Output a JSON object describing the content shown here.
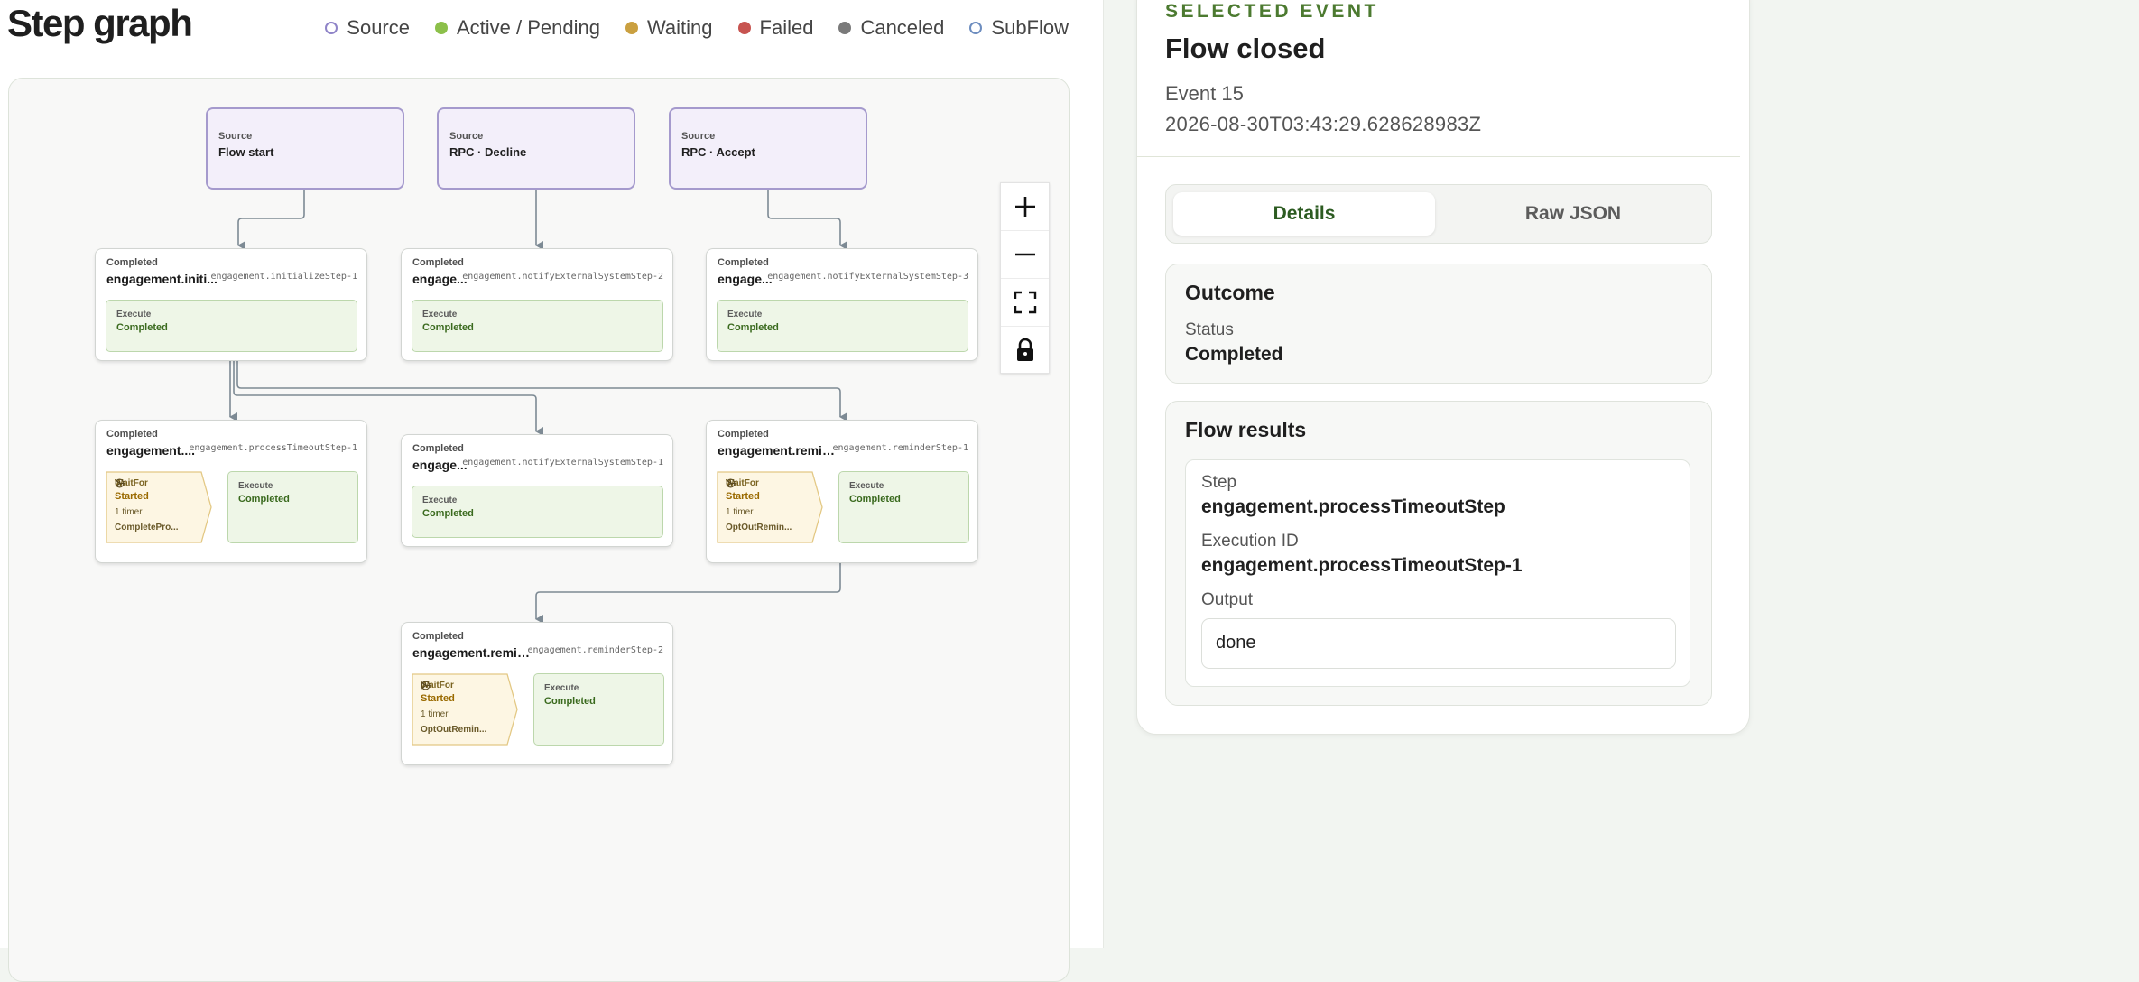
{
  "graph": {
    "title": "Step graph",
    "legend": [
      {
        "label": "Source",
        "color": "#8f84c8",
        "style": "ring"
      },
      {
        "label": "Active / Pending",
        "color": "#8cc04a",
        "style": "fill"
      },
      {
        "label": "Waiting",
        "color": "#caa040",
        "style": "fill"
      },
      {
        "label": "Failed",
        "color": "#c75450",
        "style": "fill"
      },
      {
        "label": "Canceled",
        "color": "#7a7a7a",
        "style": "fill"
      },
      {
        "label": "SubFlow",
        "color": "#6d8dbf",
        "style": "ring"
      }
    ],
    "sources": [
      {
        "kind": "Source",
        "name": "Flow start"
      },
      {
        "kind": "Source",
        "name": "RPC · Decline"
      },
      {
        "kind": "Source",
        "name": "RPC · Accept"
      }
    ],
    "steps": [
      {
        "status": "Completed",
        "name": "engagement.initi...",
        "exec_id": "engagement.initializeStep-1",
        "execute": {
          "kind": "Execute",
          "status": "Completed"
        }
      },
      {
        "status": "Completed",
        "name": "engage...",
        "exec_id": "engagement.notifyExternalSystemStep-2",
        "execute": {
          "kind": "Execute",
          "status": "Completed"
        }
      },
      {
        "status": "Completed",
        "name": "engage...",
        "exec_id": "engagement.notifyExternalSystemStep-3",
        "execute": {
          "kind": "Execute",
          "status": "Completed"
        }
      },
      {
        "status": "Completed",
        "name": "engagement....",
        "exec_id": "engagement.processTimeoutStep-1",
        "waitfor": {
          "kind": "WaitFor",
          "status": "Started",
          "timer": "1 timer",
          "signal": "CompletePro..."
        },
        "execute": {
          "kind": "Execute",
          "status": "Completed"
        }
      },
      {
        "status": "Completed",
        "name": "engage...",
        "exec_id": "engagement.notifyExternalSystemStep-1",
        "execute": {
          "kind": "Execute",
          "status": "Completed"
        }
      },
      {
        "status": "Completed",
        "name": "engagement.remin...",
        "exec_id": "engagement.reminderStep-1",
        "waitfor": {
          "kind": "WaitFor",
          "status": "Started",
          "timer": "1 timer",
          "signal": "OptOutRemin..."
        },
        "execute": {
          "kind": "Execute",
          "status": "Completed"
        }
      },
      {
        "status": "Completed",
        "name": "engagement.remin...",
        "exec_id": "engagement.reminderStep-2",
        "waitfor": {
          "kind": "WaitFor",
          "status": "Started",
          "timer": "1 timer",
          "signal": "OptOutRemin..."
        },
        "execute": {
          "kind": "Execute",
          "status": "Completed"
        }
      }
    ],
    "controls": [
      "zoom-in-icon",
      "zoom-out-icon",
      "fit-view-icon",
      "lock-icon"
    ]
  },
  "selected": {
    "label": "SELECTED EVENT",
    "title": "Flow closed",
    "event": "Event 15",
    "timestamp": "2026-08-30T03:43:29.628628983Z",
    "tabs": [
      "Details",
      "Raw JSON"
    ],
    "active_tab": "Details",
    "outcome": {
      "title": "Outcome",
      "status_label": "Status",
      "status_value": "Completed"
    },
    "results": {
      "title": "Flow results",
      "step_label": "Step",
      "step_value": "engagement.processTimeoutStep",
      "exec_label": "Execution ID",
      "exec_value": "engagement.processTimeoutStep-1",
      "output_label": "Output",
      "output_value": "done"
    }
  },
  "colors": {
    "accent_green": "#4c7a30",
    "source_fill": "#f3effa",
    "execute_fill": "#eef6e7",
    "waitfor_fill": "#fdf6e3"
  }
}
